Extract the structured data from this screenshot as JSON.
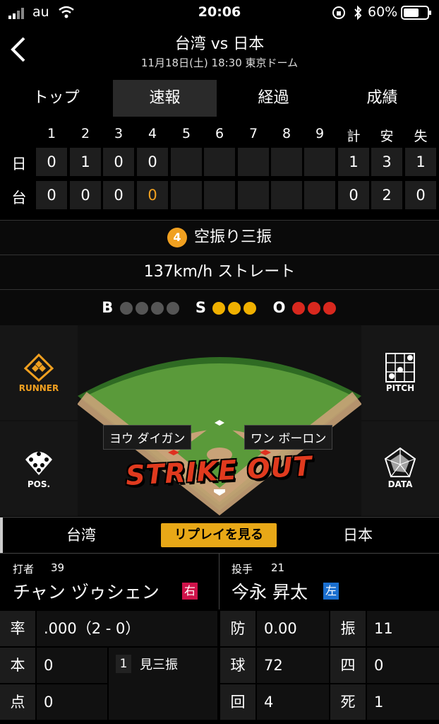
{
  "status_bar": {
    "carrier": "au",
    "time": "20:06",
    "battery": "60%"
  },
  "header": {
    "title": "台湾 vs 日本",
    "subtitle": "11月18日(土) 18:30 東京ドーム"
  },
  "tabs": [
    {
      "label": "トップ",
      "active": false
    },
    {
      "label": "速報",
      "active": true
    },
    {
      "label": "経過",
      "active": false
    },
    {
      "label": "成績",
      "active": false
    }
  ],
  "scoreboard": {
    "innings": [
      "1",
      "2",
      "3",
      "4",
      "5",
      "6",
      "7",
      "8",
      "9"
    ],
    "totals_headers": [
      "計",
      "安",
      "失"
    ],
    "rows": [
      {
        "team": "日",
        "innings": [
          "0",
          "1",
          "0",
          "0",
          "",
          "",
          "",
          "",
          ""
        ],
        "totals": [
          "1",
          "3",
          "1"
        ]
      },
      {
        "team": "台",
        "innings": [
          "0",
          "0",
          "0",
          "0",
          "",
          "",
          "",
          "",
          ""
        ],
        "totals": [
          "0",
          "2",
          "0"
        ]
      }
    ],
    "current_color": "#f0a020"
  },
  "play": {
    "number": "4",
    "result": "空振り三振",
    "pitch": "137km/h ストレート"
  },
  "count": {
    "b_label": "B",
    "s_label": "S",
    "o_label": "O",
    "balls": 0,
    "strikes": 3,
    "outs": 3
  },
  "field": {
    "runner_label": "RUNNER",
    "pos_label": "POS.",
    "pitch_label": "PITCH",
    "data_label": "DATA",
    "fielder_left": "ヨウ ダイガン",
    "fielder_right": "ワン ボーロン",
    "banner": "STRIKE OUT"
  },
  "team_bar": {
    "left": "台湾",
    "replay": "リプレイを見る",
    "right": "日本"
  },
  "batter": {
    "role": "打者",
    "number": "39",
    "name": "チャン ヅゥシェン",
    "hand": "右",
    "stats": {
      "avg_label": "率",
      "avg": ".000（2 - 0）",
      "hr_label": "本",
      "hr": "0",
      "rbi_label": "点",
      "rbi": "0",
      "log_no": "1",
      "log_result": "見三振"
    }
  },
  "pitcher": {
    "role": "投手",
    "number": "21",
    "name": "今永 昇太",
    "hand": "左",
    "stats": {
      "era_label": "防",
      "era": "0.00",
      "so_label": "振",
      "so": "11",
      "np_label": "球",
      "np": "72",
      "bb_label": "四",
      "bb": "0",
      "ip_label": "回",
      "ip": "4",
      "hbp_label": "死",
      "hbp": "1"
    }
  }
}
